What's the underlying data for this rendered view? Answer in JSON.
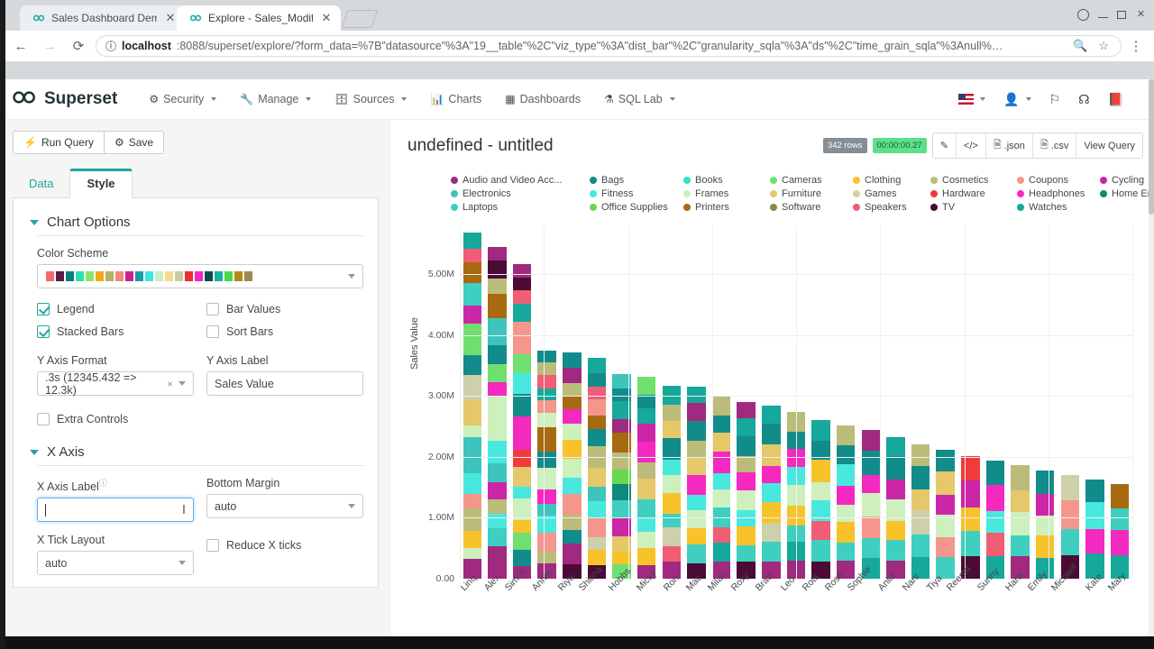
{
  "browser": {
    "tabs": [
      {
        "title": "Sales Dashboard Dem",
        "favicon": "superset-icon",
        "active": false
      },
      {
        "title": "Explore - Sales_Modifi",
        "favicon": "superset-icon",
        "active": true
      }
    ],
    "omnibox": {
      "host": "localhost",
      "url": ":8088/superset/explore/?form_data=%7B\"datasource\"%3A\"19__table\"%2C\"viz_type\"%3A\"dist_bar\"%2C\"granularity_sqla\"%3A\"ds\"%2C\"time_grain_sqla\"%3Anull%…",
      "info_icon": "info-circle-icon",
      "zoom_icon": "search-icon",
      "star_icon": "star-icon"
    },
    "back_icon": "arrow-left-icon",
    "forward_icon": "arrow-right-icon",
    "reload_icon": "reload-icon",
    "menu_icon": "kebab-menu-icon"
  },
  "navbar": {
    "brand": "Superset",
    "items": [
      {
        "label": "Security",
        "icon": "gears-icon",
        "caret": true
      },
      {
        "label": "Manage",
        "icon": "wrench-icon",
        "caret": true
      },
      {
        "label": "Sources",
        "icon": "database-icon",
        "caret": true
      },
      {
        "label": "Charts",
        "icon": "bar-chart-icon",
        "caret": false
      },
      {
        "label": "Dashboards",
        "icon": "dashboard-icon",
        "caret": false
      },
      {
        "label": "SQL Lab",
        "icon": "flask-icon",
        "caret": true
      }
    ],
    "right": [
      {
        "name": "language-flag",
        "icon": "us-flag-icon",
        "caret": true
      },
      {
        "name": "user-menu",
        "icon": "user-icon",
        "caret": true
      },
      {
        "name": "bug-report",
        "icon": "bug-icon",
        "caret": false
      },
      {
        "name": "github-link",
        "icon": "github-icon",
        "caret": false
      },
      {
        "name": "docs-link",
        "icon": "book-icon",
        "caret": false
      }
    ]
  },
  "controls": {
    "run_query": "Run Query",
    "run_query_icon": "lightning-icon",
    "save": "Save",
    "save_icon": "gear-icon",
    "tabs": [
      {
        "label": "Data",
        "active": false
      },
      {
        "label": "Style",
        "active": true
      }
    ],
    "chart_options": {
      "section_title": "Chart Options",
      "color_scheme_label": "Color Scheme",
      "color_scheme_swatches": [
        "#f46a6a",
        "#5c1b4a",
        "#0f7b7b",
        "#2fe0b0",
        "#8ce36b",
        "#f4a81d",
        "#b5b06a",
        "#f08a7a",
        "#c6258f",
        "#1d9aa8",
        "#3fe6e6",
        "#cdeec0",
        "#f7d98a",
        "#cdc9a5",
        "#ee2f2f",
        "#f327c4",
        "#0b4f4a",
        "#18b3a6",
        "#4ad94a",
        "#b08b18",
        "#9c8a4e"
      ],
      "legend_label": "Legend",
      "legend_checked": true,
      "bar_values_label": "Bar Values",
      "bar_values_checked": false,
      "stacked_bars_label": "Stacked Bars",
      "stacked_bars_checked": true,
      "sort_bars_label": "Sort Bars",
      "sort_bars_checked": false,
      "y_axis_format_label": "Y Axis Format",
      "y_axis_format_value": ".3s (12345.432 => 12.3k)",
      "y_axis_label_label": "Y Axis Label",
      "y_axis_label_value": "Sales Value",
      "extra_controls_label": "Extra Controls",
      "extra_controls_checked": false
    },
    "x_axis": {
      "section_title": "X Axis",
      "x_axis_label_label": "X Axis Label",
      "x_axis_label_value": "",
      "bottom_margin_label": "Bottom Margin",
      "bottom_margin_value": "auto",
      "x_tick_layout_label": "X Tick Layout",
      "x_tick_layout_value": "auto",
      "reduce_x_ticks_label": "Reduce X ticks",
      "reduce_x_ticks_checked": false
    }
  },
  "chart_header": {
    "title": "undefined - untitled",
    "rows_badge": "342 rows",
    "time_badge": "00:00:00.27",
    "buttons": [
      {
        "label": "",
        "icon": "edit-properties-icon"
      },
      {
        "label": "",
        "icon": "code-icon"
      },
      {
        "label": ".json",
        "icon": "file-icon"
      },
      {
        "label": ".csv",
        "icon": "file-icon"
      },
      {
        "label": "View Query",
        "icon": ""
      }
    ]
  },
  "chart_data": {
    "type": "bar",
    "title": "undefined - untitled",
    "subtype": "stacked-distribution-bar",
    "xlabel": "",
    "ylabel": "Sales Value",
    "ylim": [
      0,
      5800000
    ],
    "yticks": [
      "0.00",
      "1.00M",
      "2.00M",
      "3.00M",
      "4.00M",
      "5.00M"
    ],
    "ytick_values": [
      0,
      1000000,
      2000000,
      3000000,
      4000000,
      5000000
    ],
    "grid": true,
    "legend_position": "top",
    "categories": [
      "Linq",
      "Alex",
      "Simon",
      "Annie",
      "Riya",
      "Shiena",
      "Hobbs",
      "Micky",
      "Ron",
      "Mac",
      "Milan",
      "Roxy",
      "Brad",
      "Leo",
      "Rots",
      "Rose",
      "Sophie",
      "Aniiz",
      "Nani",
      "Tiya",
      "Reema",
      "Sunny",
      "Hank",
      "Emily",
      "Michael",
      "Kate",
      "Mary"
    ],
    "totals": [
      5680000,
      5450000,
      5170000,
      3750000,
      3710000,
      3630000,
      3360000,
      3310000,
      3170000,
      3150000,
      2990000,
      2900000,
      2840000,
      2740000,
      2600000,
      2520000,
      2440000,
      2320000,
      2200000,
      2110000,
      2020000,
      1940000,
      1860000,
      1780000,
      1700000,
      1630000,
      1550000
    ],
    "series": [
      {
        "name": "Audio and Video Acc...",
        "color": "#a02a7f"
      },
      {
        "name": "Bags",
        "color": "#128b8b"
      },
      {
        "name": "Books",
        "color": "#2fe0c3"
      },
      {
        "name": "Cameras",
        "color": "#6fe06f"
      },
      {
        "name": "Clothing",
        "color": "#f7c22a"
      },
      {
        "name": "Cosmetics",
        "color": "#bcbc7a"
      },
      {
        "name": "Coupons",
        "color": "#f4968c"
      },
      {
        "name": "Cycling",
        "color": "#cc26a8"
      },
      {
        "name": "Electronics",
        "color": "#3fc4bd"
      },
      {
        "name": "Fitness",
        "color": "#49e8df"
      },
      {
        "name": "Frames",
        "color": "#cdf0bd"
      },
      {
        "name": "Furniture",
        "color": "#e4c86a"
      },
      {
        "name": "Games",
        "color": "#cdd0a8"
      },
      {
        "name": "Hardware",
        "color": "#ef3b3b"
      },
      {
        "name": "Headphones",
        "color": "#f429c0"
      },
      {
        "name": "Home Entertainment",
        "color": "#0f8a78"
      },
      {
        "name": "Laptops",
        "color": "#3ecfc0"
      },
      {
        "name": "Office Supplies",
        "color": "#67d84f"
      },
      {
        "name": "Printers",
        "color": "#a86a10"
      },
      {
        "name": "Software",
        "color": "#8a8a4a"
      },
      {
        "name": "Speakers",
        "color": "#f05d75"
      },
      {
        "name": "TV",
        "color": "#4a0b34"
      },
      {
        "name": "Watches",
        "color": "#16a89a"
      }
    ],
    "legend_order": [
      "Audio and Video Acc...",
      "Bags",
      "Books",
      "Cameras",
      "Clothing",
      "Electronics",
      "Fitness",
      "Frames",
      "Furniture",
      "Games",
      "Laptops",
      "Office Supplies",
      "Printers",
      "Software",
      "Speakers",
      "Cosmetics",
      "Coupons",
      "Cycling",
      "Hardware",
      "Headphones",
      "Home Entertainment",
      "TV",
      "Watches"
    ],
    "legend_grid": [
      [
        "Audio and Video Acc...",
        "Bags",
        "Books",
        "Cameras",
        "Clothing",
        "Cosmetics",
        "Coupons",
        "Cycling"
      ],
      [
        "Electronics",
        "Fitness",
        "Frames",
        "Furniture",
        "Games",
        "Hardware",
        "Headphones",
        "Home Entertainment"
      ],
      [
        "Laptops",
        "Office Supplies",
        "Printers",
        "Software",
        "Speakers",
        "TV",
        "Watches"
      ]
    ],
    "stacks": [
      [
        330,
        180,
        280,
        360,
        240,
        340,
        600,
        190,
        240,
        170,
        420,
        320,
        520,
        300,
        370,
        340,
        220,
        260
      ],
      [
        560,
        300,
        250,
        240,
        300,
        330,
        380,
        760,
        250,
        300,
        330,
        450,
        420,
        260,
        320,
        230
      ],
      [
        190,
        240,
        250,
        190,
        320,
        180,
        300,
        250,
        500,
        330,
        310,
        290,
        480,
        260,
        210,
        180,
        210
      ],
      [
        250,
        200,
        300,
        280,
        200,
        230,
        360,
        260,
        410,
        240,
        200,
        190,
        230,
        200,
        200
      ],
      [
        230,
        310,
        210,
        240,
        320,
        260,
        290,
        300,
        250,
        230,
        210,
        190,
        240,
        230
      ],
      [
        200,
        240,
        180,
        300,
        250,
        220,
        280,
        330,
        260,
        200,
        240,
        190,
        210,
        230
      ],
      [
        210,
        200,
        230,
        260,
        280,
        240,
        220,
        250,
        300,
        210,
        260,
        190,
        220
      ],
      [
        190,
        240,
        220,
        200,
        260,
        280,
        230,
        290,
        250,
        210,
        200,
        240
      ],
      [
        230,
        200,
        250,
        190,
        270,
        240,
        210,
        280,
        230,
        220,
        250
      ],
      [
        200,
        250,
        210,
        240,
        200,
        260,
        230,
        220,
        250,
        240,
        210
      ],
      [
        210,
        230,
        190,
        250,
        220,
        200,
        260,
        240,
        210,
        230
      ],
      [
        220,
        200,
        240,
        210,
        250,
        230,
        200,
        260,
        220,
        210
      ],
      [
        200,
        230,
        210,
        240,
        220,
        200,
        250,
        230,
        210
      ],
      [
        210,
        220,
        200,
        230,
        240,
        210,
        220,
        200,
        230
      ],
      [
        190,
        230,
        210,
        220,
        200,
        240,
        210,
        220
      ],
      [
        200,
        210,
        230,
        190,
        220,
        240,
        210,
        230
      ],
      [
        210,
        200,
        220,
        230,
        190,
        240,
        210
      ],
      [
        190,
        220,
        200,
        230,
        210,
        240,
        200
      ],
      [
        200,
        210,
        230,
        190,
        220,
        200
      ],
      [
        210,
        200,
        220,
        190,
        230,
        210
      ],
      [
        190,
        220,
        200,
        230,
        210
      ],
      [
        200,
        210,
        190,
        230,
        220
      ],
      [
        210,
        190,
        220,
        200,
        230
      ],
      [
        200,
        220,
        190,
        210,
        230
      ],
      [
        190,
        210,
        230,
        200
      ],
      [
        210,
        200,
        220,
        190
      ],
      [
        200,
        220,
        190,
        210
      ]
    ],
    "stack_colors": [
      [
        "#a02a7f",
        "#cdf0bd",
        "#f7c22a",
        "#bcbc7a",
        "#f4968c",
        "#49e8df",
        "#3fc4bd",
        "#cdf0bd",
        "#e4c86a",
        "#e4c86a",
        "#cdd0a8",
        "#128b8b",
        "#6fe06f",
        "#cc26a8",
        "#3ecfc0",
        "#a86a10",
        "#f05d75",
        "#16a89a"
      ],
      [
        "#a02a7f",
        "#3ecfc0",
        "#49e8df",
        "#bcbc7a",
        "#cc26a8",
        "#3fc4bd",
        "#49e8df",
        "#cdf0bd",
        "#f429c0",
        "#6fe06f",
        "#128b8b",
        "#3fc4bd",
        "#a86a10",
        "#bcbc7a",
        "#4a0b34",
        "#a02a7f"
      ],
      [
        "#a02a7f",
        "#128b8b",
        "#6fe06f",
        "#f7c22a",
        "#cdf0bd",
        "#49e8df",
        "#e4c86a",
        "#ef3b3b",
        "#f429c0",
        "#128b8b",
        "#49e8df",
        "#6fe06f",
        "#f4968c",
        "#16a89a",
        "#f05d75",
        "#4a0b34",
        "#a02a7f"
      ],
      [
        "#a02a7f",
        "#bcbc7a",
        "#f4968c",
        "#49e8df",
        "#3fc4bd",
        "#f429c0",
        "#cdf0bd",
        "#128b8b",
        "#a86a10",
        "#cdf0bd",
        "#f4968c",
        "#16a89a",
        "#f05d75",
        "#bcbc7a",
        "#128b8b"
      ],
      [
        "#4a0b34",
        "#a02a7f",
        "#128b8b",
        "#bcbc7a",
        "#f4968c",
        "#49e8df",
        "#cdf0bd",
        "#f7c22a",
        "#cdf0bd",
        "#f429c0",
        "#a86a10",
        "#bcbc7a",
        "#a02a7f",
        "#128b8b"
      ],
      [
        "#4a0b34",
        "#f7c22a",
        "#cdd0a8",
        "#f4968c",
        "#49e8df",
        "#3fc4bd",
        "#e4c86a",
        "#bcbc7a",
        "#128b8b",
        "#a86a10",
        "#f4968c",
        "#f05d75",
        "#128b8b",
        "#16a89a"
      ],
      [
        "#6fe06f",
        "#f7c22a",
        "#e4c86a",
        "#cc26a8",
        "#3ecfc0",
        "#0f8a78",
        "#67d84f",
        "#bcbc7a",
        "#a86a10",
        "#a02a7f",
        "#16a89a",
        "#128b8b",
        "#3fc4bd"
      ],
      [
        "#a02a7f",
        "#f7c22a",
        "#cdf0bd",
        "#49e8df",
        "#3ecfc0",
        "#e4c86a",
        "#bcbc7a",
        "#f429c0",
        "#cc26a8",
        "#16a89a",
        "#128b8b",
        "#6fe06f"
      ],
      [
        "#a02a7f",
        "#f05d75",
        "#cdd0a8",
        "#3ecfc0",
        "#f7c22a",
        "#cdf0bd",
        "#49e8df",
        "#128b8b",
        "#e4c86a",
        "#bcbc7a",
        "#16a89a"
      ],
      [
        "#4a0b34",
        "#3ecfc0",
        "#f7c22a",
        "#cdf0bd",
        "#49e8df",
        "#f429c0",
        "#e4c86a",
        "#bcbc7a",
        "#128b8b",
        "#a02a7f",
        "#16a89a"
      ],
      [
        "#a02a7f",
        "#16a89a",
        "#f05d75",
        "#3ecfc0",
        "#cdf0bd",
        "#49e8df",
        "#f429c0",
        "#e4c86a",
        "#128b8b",
        "#bcbc7a"
      ],
      [
        "#4a0b34",
        "#3ecfc0",
        "#f7c22a",
        "#49e8df",
        "#cdf0bd",
        "#f429c0",
        "#bcbc7a",
        "#128b8b",
        "#16a89a",
        "#a02a7f"
      ],
      [
        "#a02a7f",
        "#3ecfc0",
        "#cdd0a8",
        "#f7c22a",
        "#49e8df",
        "#f429c0",
        "#e4c86a",
        "#128b8b",
        "#16a89a"
      ],
      [
        "#a02a7f",
        "#16a89a",
        "#3ecfc0",
        "#f7c22a",
        "#cdf0bd",
        "#49e8df",
        "#f429c0",
        "#128b8b",
        "#bcbc7a"
      ],
      [
        "#4a0b34",
        "#3ecfc0",
        "#f05d75",
        "#49e8df",
        "#cdf0bd",
        "#f7c22a",
        "#128b8b",
        "#16a89a"
      ],
      [
        "#a02a7f",
        "#3ecfc0",
        "#f7c22a",
        "#cdf0bd",
        "#f429c0",
        "#49e8df",
        "#128b8b",
        "#bcbc7a"
      ],
      [
        "#16a89a",
        "#3ecfc0",
        "#f4968c",
        "#cdf0bd",
        "#f429c0",
        "#128b8b",
        "#a02a7f"
      ],
      [
        "#a02a7f",
        "#3ecfc0",
        "#f7c22a",
        "#cdf0bd",
        "#cc26a8",
        "#128b8b",
        "#16a89a"
      ],
      [
        "#16a89a",
        "#3ecfc0",
        "#cdd0a8",
        "#e4c86a",
        "#128b8b",
        "#bcbc7a"
      ],
      [
        "#3ecfc0",
        "#f4968c",
        "#cdf0bd",
        "#cc26a8",
        "#e4c86a",
        "#128b8b"
      ],
      [
        "#4a0b34",
        "#3ecfc0",
        "#f7c22a",
        "#cc26a8",
        "#ef3b3b"
      ],
      [
        "#16a89a",
        "#f05d75",
        "#49e8df",
        "#f429c0",
        "#128b8b"
      ],
      [
        "#a02a7f",
        "#3ecfc0",
        "#cdf0bd",
        "#e4c86a",
        "#bcbc7a"
      ],
      [
        "#16a89a",
        "#f7c22a",
        "#cdf0bd",
        "#cc26a8",
        "#128b8b"
      ],
      [
        "#4a0b34",
        "#3ecfc0",
        "#f4968c",
        "#cdd0a8"
      ],
      [
        "#16a89a",
        "#f429c0",
        "#49e8df",
        "#128b8b"
      ],
      [
        "#16a89a",
        "#f429c0",
        "#3ecfc0",
        "#a86a10"
      ]
    ]
  }
}
